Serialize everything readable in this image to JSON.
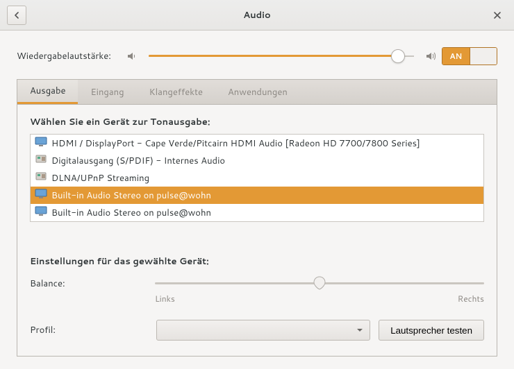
{
  "window": {
    "title": "Audio"
  },
  "volume": {
    "label": "Wiedergabelautstärke:",
    "toggle_on": "AN"
  },
  "tabs": [
    {
      "label": "Ausgabe",
      "active": true
    },
    {
      "label": "Eingang"
    },
    {
      "label": "Klangeffekte"
    },
    {
      "label": "Anwendungen"
    }
  ],
  "output": {
    "choose_label": "Wählen Sie ein Gerät zur Tonausgabe:",
    "devices": [
      {
        "label": "HDMI / DisplayPort - Cape Verde/Pitcairn HDMI Audio [Radeon HD 7700/7800 Series]",
        "icon": "monitor"
      },
      {
        "label": "Digitalausgang (S/PDIF) - Internes Audio",
        "icon": "card"
      },
      {
        "label": "DLNA/UPnP Streaming",
        "icon": "card"
      },
      {
        "label": "Built-in Audio Stereo on pulse@wohn",
        "icon": "monitor",
        "selected": true
      },
      {
        "label": "Built-in Audio Stereo on pulse@wohn",
        "icon": "monitor"
      }
    ],
    "settings_label": "Einstellungen für das gewählte Gerät:",
    "balance": {
      "label": "Balance:",
      "left": "Links",
      "right": "Rechts"
    },
    "profile": {
      "label": "Profil:",
      "test_button": "Lautsprecher testen"
    }
  }
}
